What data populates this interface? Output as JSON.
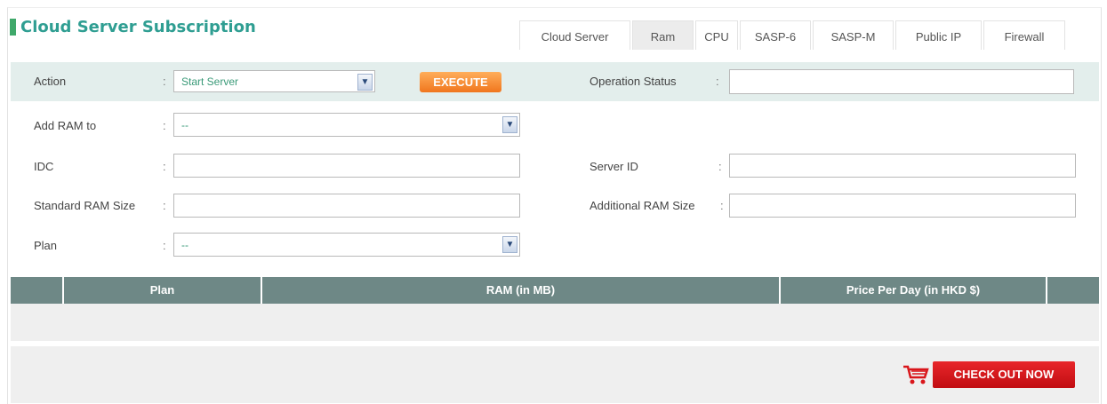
{
  "page": {
    "title": "Cloud Server Subscription"
  },
  "tabs": [
    {
      "label": "Cloud Server",
      "active": false
    },
    {
      "label": "Ram",
      "active": true
    },
    {
      "label": "CPU",
      "active": false
    },
    {
      "label": "SASP-6",
      "active": false
    },
    {
      "label": "SASP-M",
      "active": false
    },
    {
      "label": "Public IP",
      "active": false
    },
    {
      "label": "Firewall",
      "active": false
    }
  ],
  "form": {
    "colon": ":",
    "action": {
      "label": "Action",
      "value": "Start Server"
    },
    "execute_label": "EXECUTE",
    "operation_status": {
      "label": "Operation Status",
      "value": ""
    },
    "add_ram_to": {
      "label": "Add RAM to",
      "value": "--"
    },
    "idc": {
      "label": "IDC",
      "value": ""
    },
    "server_id": {
      "label": "Server ID",
      "value": ""
    },
    "standard_ram_size": {
      "label": "Standard RAM Size",
      "value": ""
    },
    "additional_ram_size": {
      "label": "Additional RAM Size",
      "value": ""
    },
    "plan": {
      "label": "Plan",
      "value": "--"
    }
  },
  "table": {
    "columns": [
      "",
      "Plan",
      "RAM (in MB)",
      "Price Per Day (in HKD $)",
      ""
    ],
    "rows": []
  },
  "checkout": {
    "label": "CHECK OUT NOW"
  },
  "colors": {
    "accent": "#2f9e92",
    "header": "#6e8886",
    "execute": "#f0761e",
    "checkout": "#c10d12"
  }
}
